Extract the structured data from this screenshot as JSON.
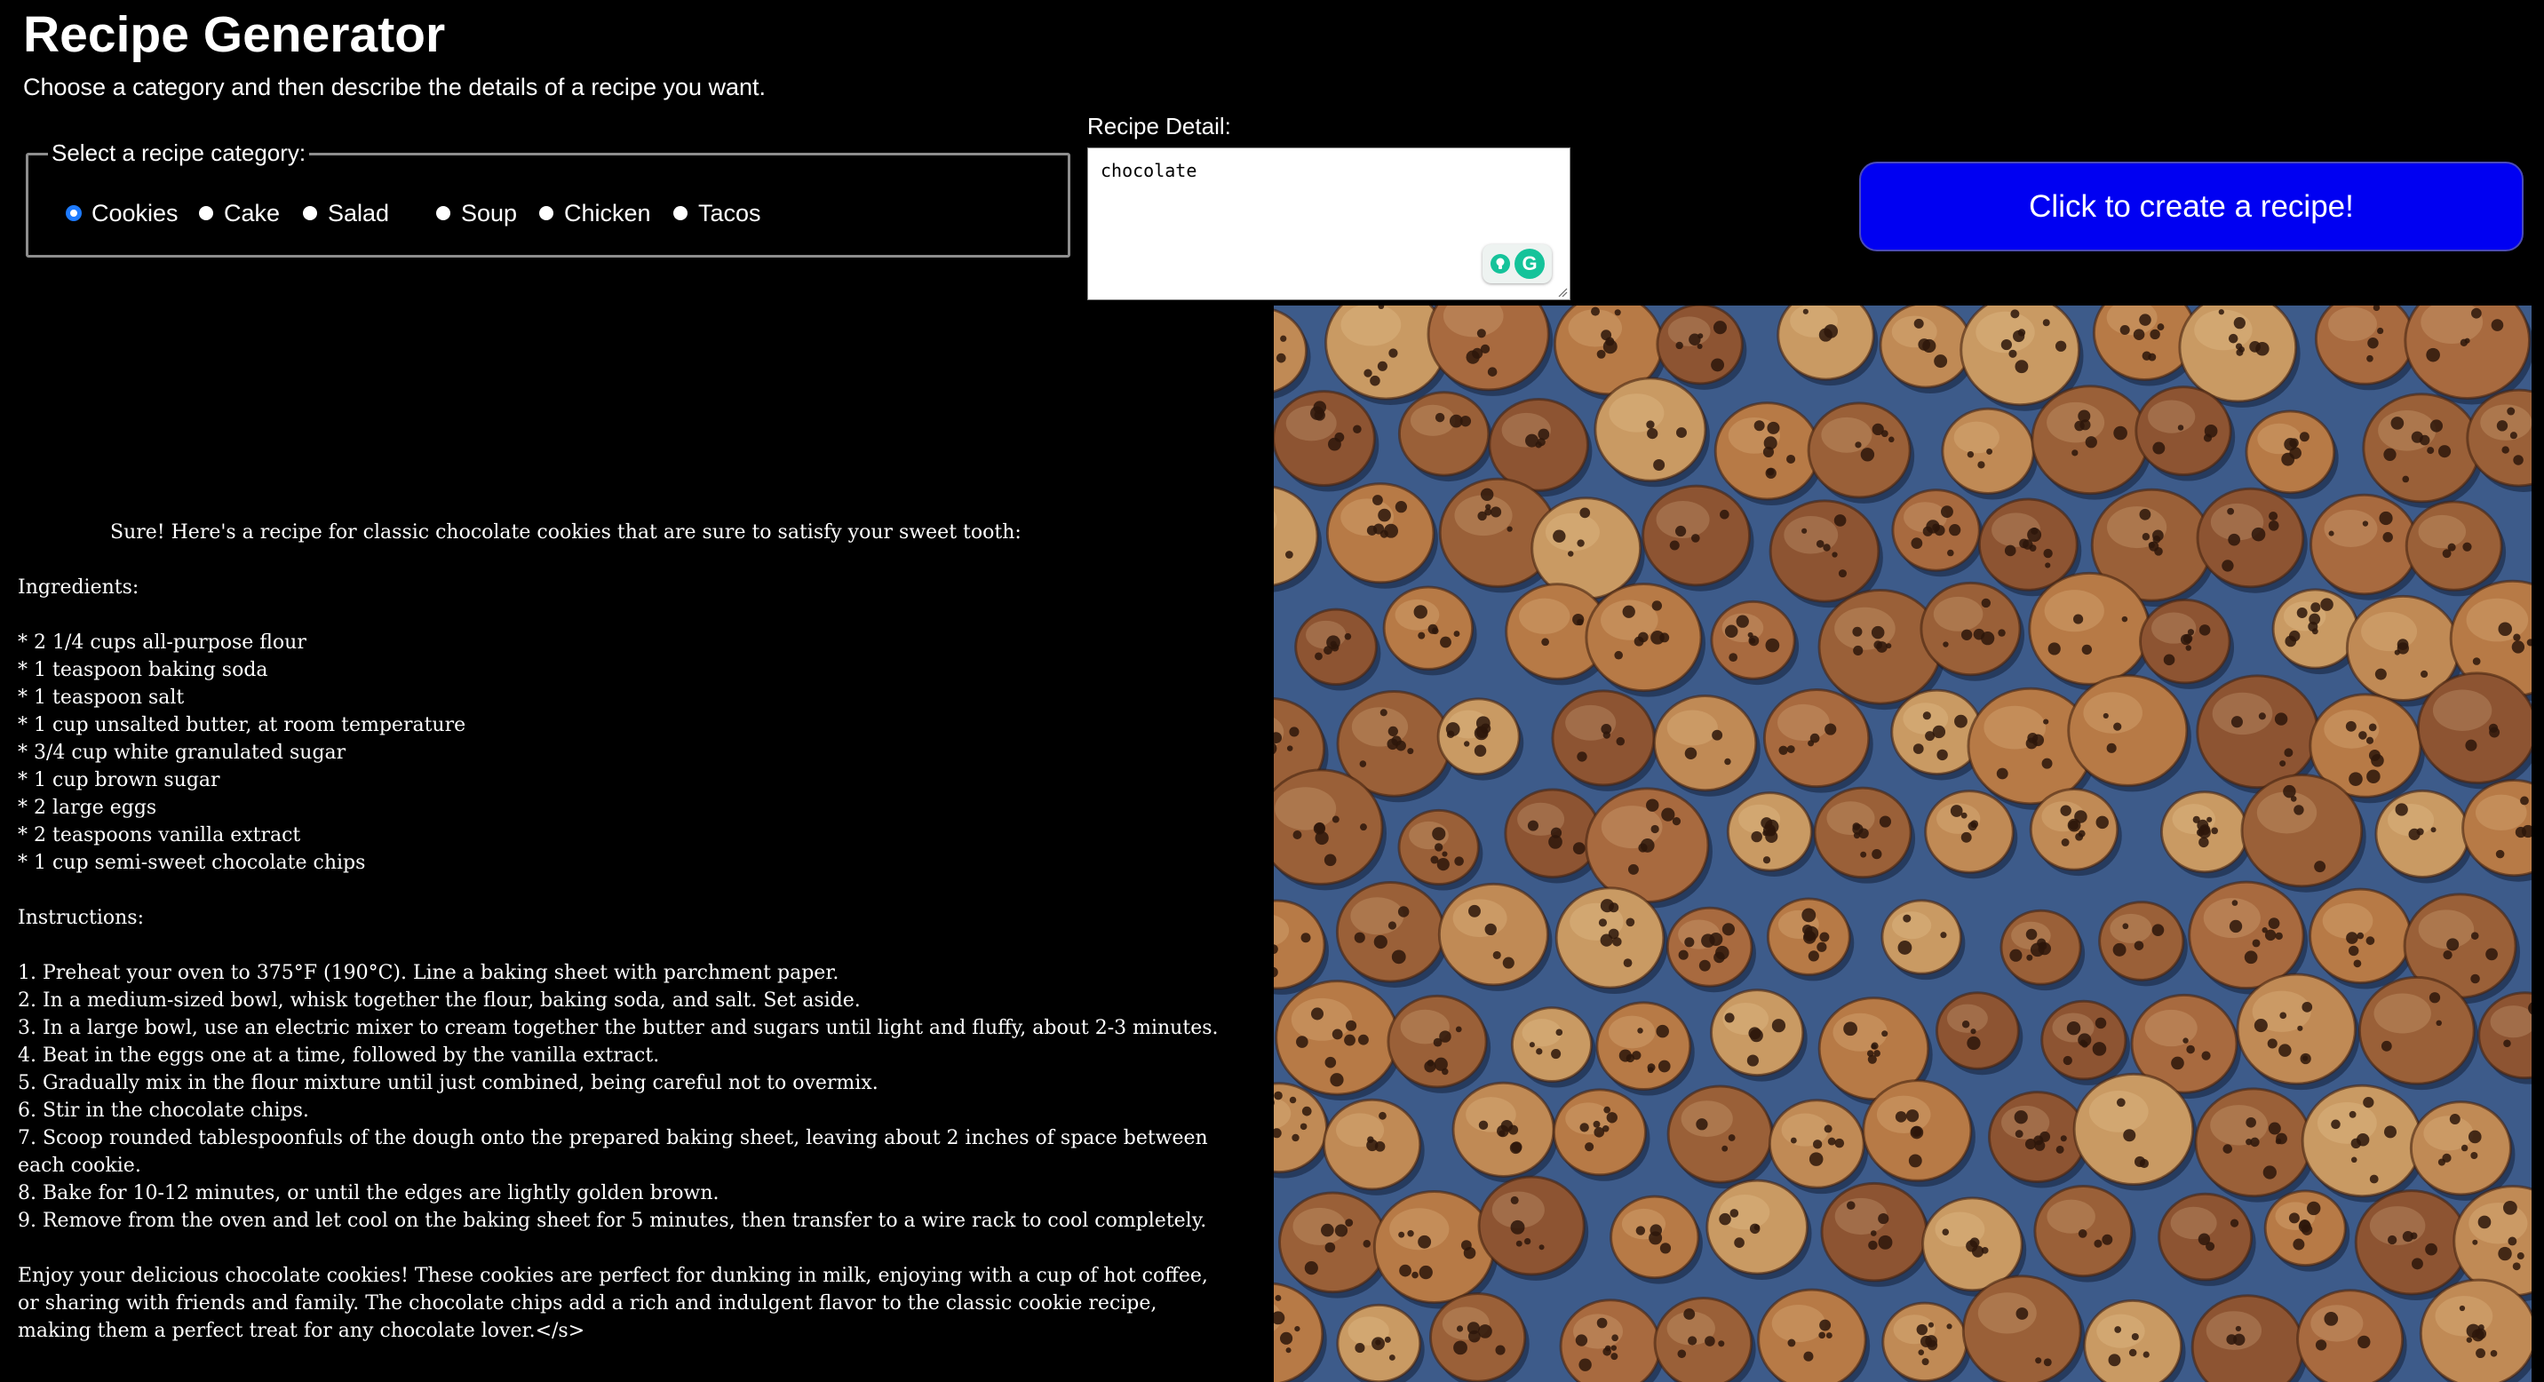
{
  "header": {
    "title": "Recipe Generator",
    "subtitle": "Choose a category and then describe the details of a recipe you want."
  },
  "category": {
    "legend": "Select a recipe category:",
    "options": [
      {
        "label": "Cookies",
        "checked": true
      },
      {
        "label": "Cake",
        "checked": false
      },
      {
        "label": "Salad",
        "checked": false
      },
      {
        "label": "Soup",
        "checked": false
      },
      {
        "label": "Chicken",
        "checked": false
      },
      {
        "label": "Tacos",
        "checked": false
      }
    ]
  },
  "detail": {
    "label": "Recipe Detail:",
    "value": "chocolate",
    "assistant_icons": [
      "lightbulb-icon",
      "grammarly-icon"
    ]
  },
  "create_button": {
    "label": "Click to create a recipe!",
    "color": "#0000f2"
  },
  "recipe": {
    "intro": "Sure! Here's a recipe for classic chocolate cookies that are sure to satisfy your sweet tooth:",
    "ingredients_heading": "Ingredients:",
    "ingredients": [
      "* 2 1/4 cups all-purpose flour",
      "* 1 teaspoon baking soda",
      "* 1 teaspoon salt",
      "* 1 cup unsalted butter, at room temperature",
      "* 3/4 cup white granulated sugar",
      "* 1 cup brown sugar",
      "* 2 large eggs",
      "* 2 teaspoons vanilla extract",
      "* 1 cup semi-sweet chocolate chips"
    ],
    "instructions_heading": "Instructions:",
    "instructions": [
      "1. Preheat your oven to 375°F (190°C). Line a baking sheet with parchment paper.",
      "2. In a medium-sized bowl, whisk together the flour, baking soda, and salt. Set aside.",
      "3. In a large bowl, use an electric mixer to cream together the butter and sugars until light and fluffy, about 2-3 minutes.",
      "4. Beat in the eggs one at a time, followed by the vanilla extract.",
      "5. Gradually mix in the flour mixture until just combined, being careful not to overmix.",
      "6. Stir in the chocolate chips.",
      "7. Scoop rounded tablespoonfuls of the dough onto the prepared baking sheet, leaving about 2 inches of space between each cookie.",
      "8. Bake for 10-12 minutes, or until the edges are lightly golden brown.",
      "9. Remove from the oven and let cool on the baking sheet for 5 minutes, then transfer to a wire rack to cool completely."
    ],
    "closing": "Enjoy your delicious chocolate cookies! These cookies are perfect for dunking in milk, enjoying with a cup of hot coffee, or sharing with friends and family. The chocolate chips add a rich and indulgent flavor to the classic cookie recipe, making them a perfect treat for any chocolate lover.</s>"
  },
  "image": {
    "background_color": "#3d5b8a",
    "cookie_colors": [
      "#a86a3f",
      "#c08a55",
      "#8d5432",
      "#b77a46",
      "#9a6038",
      "#c99a63"
    ]
  }
}
